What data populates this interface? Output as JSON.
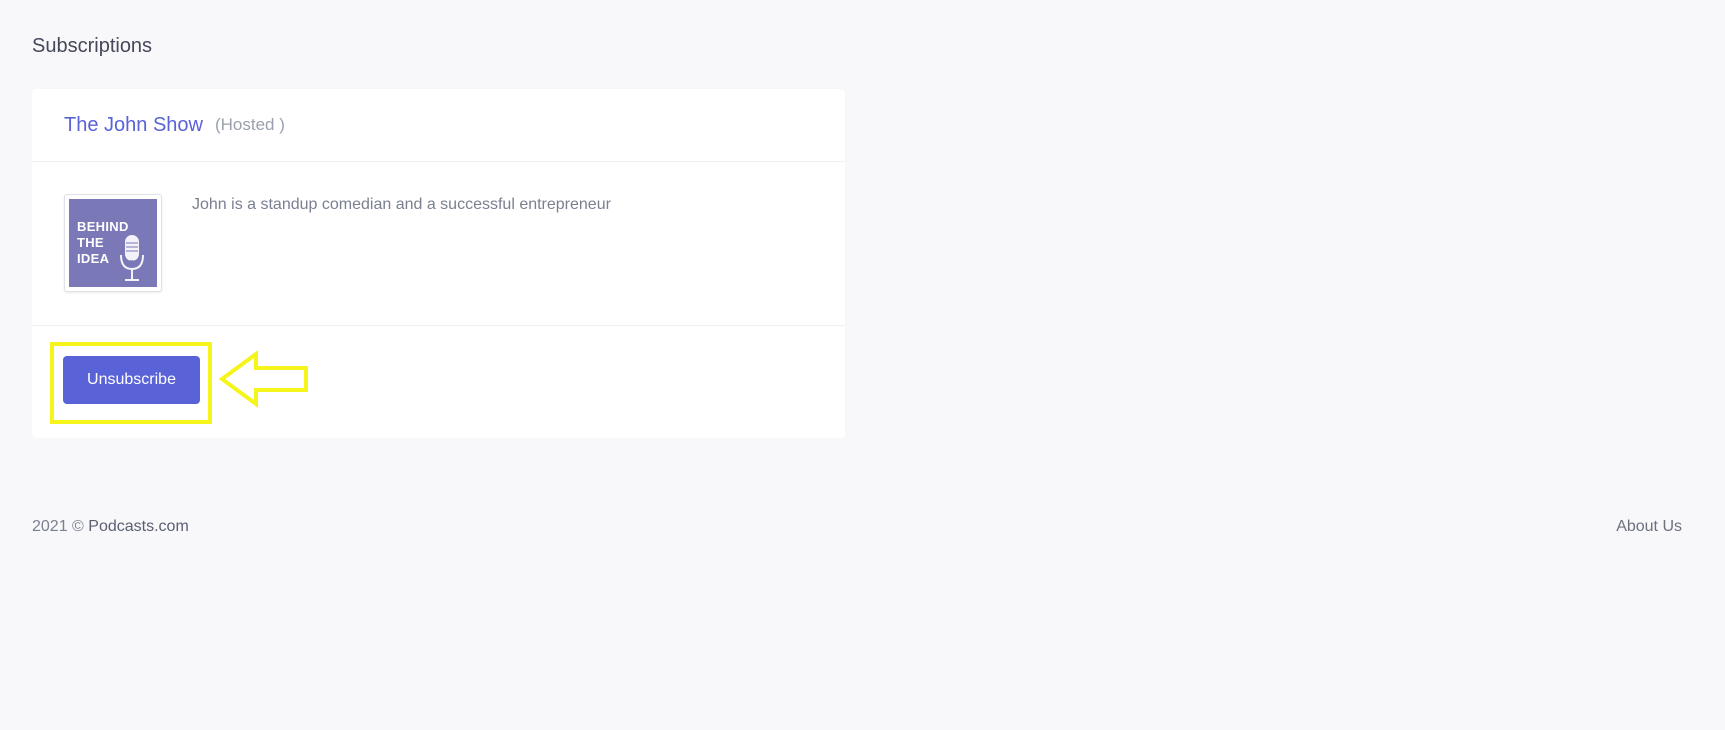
{
  "page": {
    "heading": "Subscriptions"
  },
  "subscription": {
    "title": "The John Show",
    "tag": "(Hosted )",
    "description": "John is a standup comedian and a successful entrepreneur",
    "cover": {
      "line1": "BEHIND",
      "line2": "THE",
      "line3": "IDEA",
      "icon": "microphone-icon"
    },
    "unsubscribe_label": "Unsubscribe"
  },
  "annotation": {
    "highlight_color": "#f5f51c",
    "arrow_icon": "arrow-left-outline-icon"
  },
  "footer": {
    "year": "2021 ©",
    "brand": "Podcasts.com",
    "about_label": "About Us"
  },
  "colors": {
    "accent": "#5a62d8",
    "background": "#f8f8fa",
    "cover": "#7a78b6"
  }
}
